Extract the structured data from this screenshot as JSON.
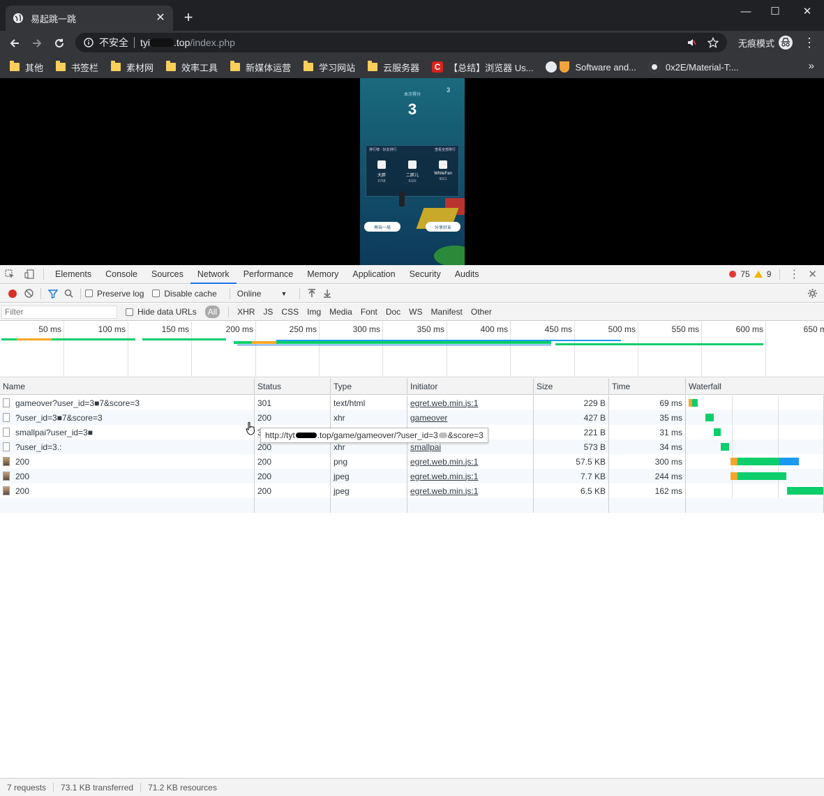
{
  "browser": {
    "tab_title": "易起跳一跳",
    "address": {
      "security_label": "不安全",
      "host_start": "tyi",
      "host_end": ".top",
      "path": "/index.php"
    },
    "incognito_label": "无痕模式",
    "bookmarks": [
      {
        "label": "其他",
        "icon": "folder-icon"
      },
      {
        "label": "书签栏",
        "icon": "folder-icon"
      },
      {
        "label": "素材网",
        "icon": "folder-icon"
      },
      {
        "label": "效率工具",
        "icon": "folder-icon"
      },
      {
        "label": "新媒体运营",
        "icon": "folder-icon"
      },
      {
        "label": "学习网站",
        "icon": "folder-icon"
      },
      {
        "label": "云服务器",
        "icon": "folder-icon"
      },
      {
        "label": "【总结】浏览器 Us...",
        "icon": "csdn-icon"
      },
      {
        "label": "Software and...",
        "icon": "globe-icon"
      },
      {
        "label": "0x2E/Material-T:...",
        "icon": "github-icon"
      }
    ]
  },
  "game": {
    "score_label": "本次得分",
    "score": "3",
    "mini_score": "3",
    "board_left": "排行榜 · 好友排行",
    "board_right": "查看全部排行",
    "players": [
      {
        "name": "大胖",
        "score": "5758"
      },
      {
        "name": "二胖儿",
        "score": "6326"
      },
      {
        "name": "WhiteFan",
        "score": "9021"
      }
    ],
    "again_button": "再玩一局",
    "share_button": "分享好友"
  },
  "devtools": {
    "panels": [
      "Elements",
      "Console",
      "Sources",
      "Network",
      "Performance",
      "Memory",
      "Application",
      "Security",
      "Audits"
    ],
    "active_panel": "Network",
    "error_count": "75",
    "warning_count": "9",
    "preserve_log_label": "Preserve log",
    "disable_cache_label": "Disable cache",
    "throttling": "Online",
    "filter_placeholder": "Filter",
    "hide_data_urls_label": "Hide data URLs",
    "filter_types": [
      "All",
      "XHR",
      "JS",
      "CSS",
      "Img",
      "Media",
      "Font",
      "Doc",
      "WS",
      "Manifest",
      "Other"
    ],
    "overview_ticks": [
      "50 ms",
      "100 ms",
      "150 ms",
      "200 ms",
      "250 ms",
      "300 ms",
      "350 ms",
      "400 ms",
      "450 ms",
      "500 ms",
      "550 ms",
      "600 ms",
      "650 m"
    ],
    "columns": [
      "Name",
      "Status",
      "Type",
      "Initiator",
      "Size",
      "Time",
      "Waterfall"
    ],
    "requests": [
      {
        "name": "gameover?user_id=3■7&score=3",
        "status": "301",
        "type": "text/html",
        "initiator": "egret.web.min.js:1",
        "size": "229 B",
        "time": "69 ms",
        "icon": "document-icon"
      },
      {
        "name": "?user_id=3■7&score=3",
        "status": "200",
        "type": "xhr",
        "initiator": "gameover",
        "size": "427 B",
        "time": "35 ms",
        "icon": "document-icon"
      },
      {
        "name": "smallpai?user_id=3■",
        "status": "3",
        "type": "",
        "initiator": "",
        "size": "221 B",
        "time": "31 ms",
        "icon": "document-icon"
      },
      {
        "name": "?user_id=3.:",
        "status": "200",
        "type": "xhr",
        "initiator": "smallpai",
        "size": "573 B",
        "time": "34 ms",
        "icon": "document-icon"
      },
      {
        "name": "200",
        "status": "200",
        "type": "png",
        "initiator": "egret.web.min.js:1",
        "size": "57.5 KB",
        "time": "300 ms",
        "icon": "image-icon"
      },
      {
        "name": "200",
        "status": "200",
        "type": "jpeg",
        "initiator": "egret.web.min.js:1",
        "size": "7.7 KB",
        "time": "244 ms",
        "icon": "image-icon"
      },
      {
        "name": "200",
        "status": "200",
        "type": "jpeg",
        "initiator": "egret.web.min.js:1",
        "size": "6.5 KB",
        "time": "162 ms",
        "icon": "image-icon"
      }
    ],
    "tooltip": {
      "start": "http://tyt",
      "middle": ".top/game/gameover/?user_id=3",
      "end": "&score=3"
    },
    "status": {
      "requests": "7 requests",
      "transferred": "73.1 KB transferred",
      "resources": "71.2 KB resources"
    }
  },
  "colors": {
    "waiting_green": "#0cce6b",
    "download_blue": "#1a9bf0",
    "queue_orange": "#f4a62a",
    "record_red": "#d93025"
  }
}
